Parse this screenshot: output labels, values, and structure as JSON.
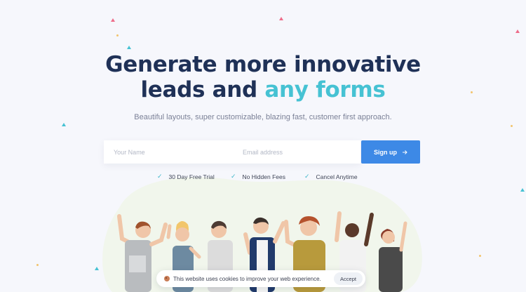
{
  "hero": {
    "title_line1": "Generate more innovative",
    "title_line2_start": "leads and ",
    "title_line2_accent": "any forms",
    "subtitle": "Beautiful layouts, super customizable, blazing fast, customer first approach."
  },
  "form": {
    "name_placeholder": "Your Name",
    "email_placeholder": "Email address",
    "signup_label": "Sign up",
    "signup_icon": "arrow-right-icon"
  },
  "features": [
    "30 Day Free Trial",
    "No Hidden Fees",
    "Cancel Anytime"
  ],
  "cookie_banner": {
    "icon": "cookie-icon",
    "text": "This website uses cookies to improve your web experience.",
    "accept_label": "Accept"
  },
  "colors": {
    "primary": "#3d89e6",
    "accent": "#46c2d3",
    "heading": "#1f3157",
    "background": "#f6f7fc"
  }
}
